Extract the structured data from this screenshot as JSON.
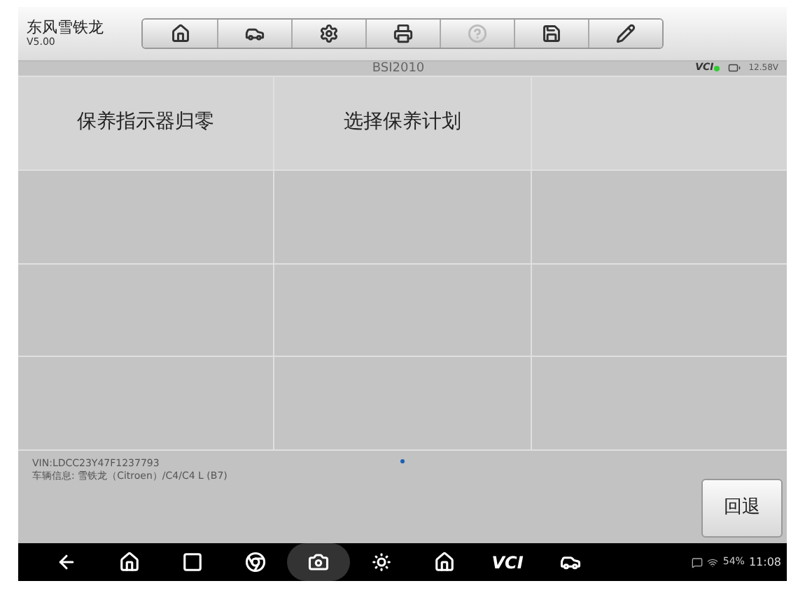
{
  "header": {
    "title": "东风雪铁龙",
    "version": "V5.00"
  },
  "toolbar": [
    {
      "kind": "home",
      "disabled": false
    },
    {
      "kind": "car",
      "disabled": false
    },
    {
      "kind": "settings",
      "disabled": false
    },
    {
      "kind": "print",
      "disabled": false
    },
    {
      "kind": "help",
      "disabled": true
    },
    {
      "kind": "save",
      "disabled": false
    },
    {
      "kind": "edit",
      "disabled": false
    }
  ],
  "title_bar": {
    "title": "BSI2010",
    "vci": "VCI",
    "vci_connected": true,
    "voltage": "12.58V"
  },
  "grid": {
    "cells": [
      {
        "label": "保养指示器归零"
      },
      {
        "label": "选择保养计划"
      }
    ]
  },
  "footer": {
    "vin": "VIN:LDCC23Y47F1237793",
    "vehicle_info": "车辆信息: 雪铁龙（Citroen）/C4/C4 L (B7)",
    "back_button": "回退"
  },
  "nav_bar": {
    "items": [
      {
        "kind": "back",
        "selected": false
      },
      {
        "kind": "home",
        "selected": false
      },
      {
        "kind": "recent",
        "selected": false
      },
      {
        "kind": "browser",
        "selected": false
      },
      {
        "kind": "camera",
        "selected": true
      },
      {
        "kind": "display",
        "selected": false
      },
      {
        "kind": "m",
        "selected": false
      },
      {
        "kind": "vci",
        "label": "VCI",
        "selected": false
      },
      {
        "kind": "car",
        "selected": false
      }
    ],
    "battery": "54%",
    "time": "11:08"
  }
}
